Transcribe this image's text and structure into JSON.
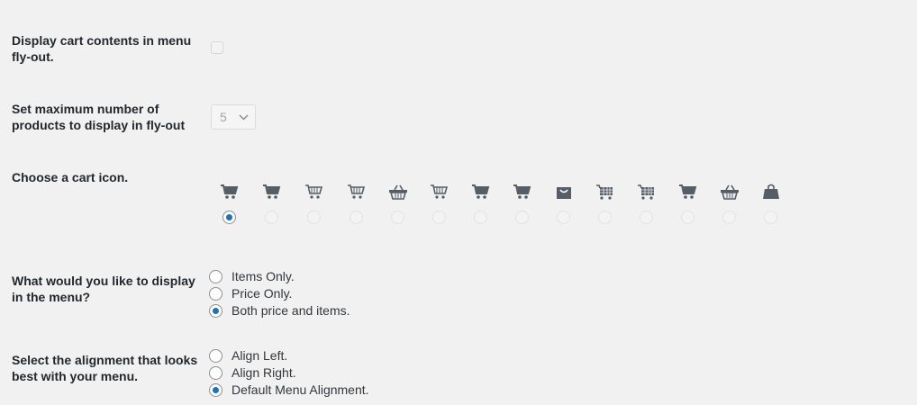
{
  "settings": {
    "display_cart_contents": {
      "label": "Display cart contents in menu fly-out.",
      "checked": false
    },
    "max_products": {
      "label": "Set maximum number of products to display in fly-out",
      "value": "5"
    },
    "cart_icon": {
      "label": "Choose a cart icon.",
      "selected_index": 0,
      "icons": [
        "cart-icon-1",
        "cart-icon-2",
        "cart-icon-3",
        "cart-icon-4",
        "basket-icon-1",
        "cart-icon-5",
        "cart-icon-6",
        "cart-icon-7",
        "bag-icon-1",
        "cart-icon-8",
        "cart-icon-9",
        "cart-icon-10",
        "basket-icon-2",
        "bag-icon-2"
      ]
    },
    "display_in_menu": {
      "label": "What would you like to display in the menu?",
      "options": [
        "Items Only.",
        "Price Only.",
        "Both price and items."
      ],
      "selected_index": 2
    },
    "alignment": {
      "label": "Select the alignment that looks best with your menu.",
      "options": [
        "Align Left.",
        "Align Right.",
        "Default Menu Alignment."
      ],
      "selected_index": 2
    }
  },
  "colors": {
    "background": "#f1f1f1",
    "text": "#23282d",
    "radio_checked": "#2271b1",
    "icon": "#555d66"
  }
}
